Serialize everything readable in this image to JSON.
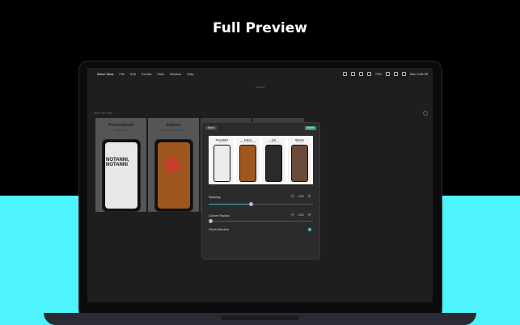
{
  "hero": {
    "title": "Full Preview"
  },
  "menubar": {
    "items": [
      "Store View",
      "File",
      "Edit",
      "Format",
      "View",
      "Window",
      "Help"
    ],
    "battery": "79%",
    "clock": "Mon 2:58 08"
  },
  "window": {
    "doc_title": "Untitled",
    "side_label": "Store Set View"
  },
  "cards": [
    {
      "title": "Personalized",
      "subtitle": "Unlock Gold",
      "phone_text": "NOTANNI, NOTANNI"
    },
    {
      "title": "Explore",
      "subtitle": "Enjoy & Order Recipes"
    }
  ],
  "panel": {
    "back_label": "Back",
    "save_label": "Save",
    "mini_screens": [
      {
        "title": "Personalized",
        "subtitle": "Unlock Gold"
      },
      {
        "title": "Explore",
        "subtitle": "Enjoy & Order Recipes"
      },
      {
        "title": "Join",
        "subtitle": "Join Community"
      },
      {
        "title": "Welcome",
        "subtitle": "Be Yourself"
      }
    ],
    "spacing": {
      "label": "Spacing",
      "value": "0.00",
      "fraction": 0.41
    },
    "corner_radius": {
      "label": "Corner Radius",
      "value": "0.00",
      "fraction": 0.0
    },
    "show_borders": {
      "label": "Show Borders",
      "checked": true
    }
  },
  "colors": {
    "band": "#4df3fd",
    "accent": "#4ab0c8",
    "save": "#3a9a6a"
  }
}
